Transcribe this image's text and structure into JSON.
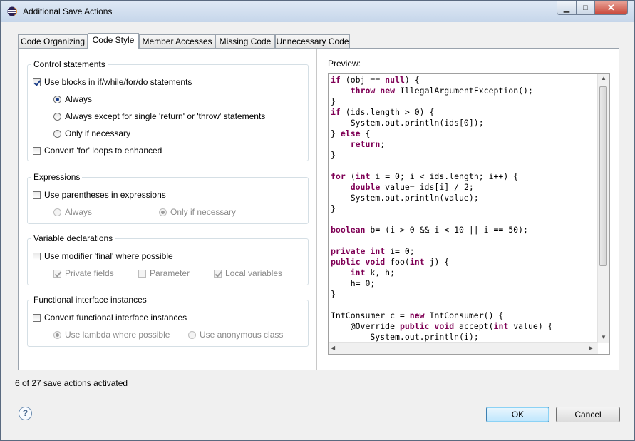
{
  "window": {
    "title": "Additional Save Actions",
    "controls": {
      "minimize": "▁",
      "maximize": "□",
      "close": "✕"
    }
  },
  "tabs": [
    {
      "label": "Code Organizing",
      "active": false
    },
    {
      "label": "Code Style",
      "active": true
    },
    {
      "label": "Member Accesses",
      "active": false
    },
    {
      "label": "Missing Code",
      "active": false
    },
    {
      "label": "Unnecessary Code",
      "active": false
    }
  ],
  "groups": {
    "control": {
      "label": "Control statements",
      "use_blocks": {
        "label": "Use blocks in if/while/for/do statements",
        "checked": true
      },
      "always": {
        "label": "Always",
        "checked": true
      },
      "always_except": {
        "label": "Always except for single 'return' or 'throw' statements",
        "checked": false
      },
      "only_if_necessary": {
        "label": "Only if necessary",
        "checked": false
      },
      "convert_for": {
        "label": "Convert 'for' loops to enhanced",
        "checked": false
      }
    },
    "expressions": {
      "label": "Expressions",
      "use_parentheses": {
        "label": "Use parentheses in expressions",
        "checked": false
      },
      "always": {
        "label": "Always",
        "checked": false
      },
      "only_if_necessary": {
        "label": "Only if necessary",
        "checked": true
      }
    },
    "variables": {
      "label": "Variable declarations",
      "use_final": {
        "label": "Use modifier 'final' where possible",
        "checked": false
      },
      "private_fields": {
        "label": "Private fields",
        "checked": true
      },
      "parameter": {
        "label": "Parameter",
        "checked": false
      },
      "local_variables": {
        "label": "Local variables",
        "checked": true
      }
    },
    "functional": {
      "label": "Functional interface instances",
      "convert": {
        "label": "Convert functional interface instances",
        "checked": false
      },
      "use_lambda": {
        "label": "Use lambda where possible",
        "checked": true
      },
      "use_anonymous": {
        "label": "Use anonymous class",
        "checked": false
      }
    }
  },
  "preview": {
    "label": "Preview:",
    "lines": [
      [
        [
          "kw",
          "if"
        ],
        [
          "t",
          " (obj == "
        ],
        [
          "kw",
          "null"
        ],
        [
          "t",
          ") {"
        ]
      ],
      [
        [
          "t",
          "    "
        ],
        [
          "kw",
          "throw"
        ],
        [
          "t",
          " "
        ],
        [
          "kw",
          "new"
        ],
        [
          "t",
          " IllegalArgumentException();"
        ]
      ],
      [
        [
          "t",
          "}"
        ]
      ],
      [
        [
          "kw",
          "if"
        ],
        [
          "t",
          " (ids.length > 0) {"
        ]
      ],
      [
        [
          "t",
          "    System.out.println(ids[0]);"
        ]
      ],
      [
        [
          "t",
          "} "
        ],
        [
          "kw",
          "else"
        ],
        [
          "t",
          " {"
        ]
      ],
      [
        [
          "t",
          "    "
        ],
        [
          "kw",
          "return"
        ],
        [
          "t",
          ";"
        ]
      ],
      [
        [
          "t",
          "}"
        ]
      ],
      [
        [
          "t",
          ""
        ]
      ],
      [
        [
          "kw",
          "for"
        ],
        [
          "t",
          " ("
        ],
        [
          "kw",
          "int"
        ],
        [
          "t",
          " i = 0; i < ids.length; i++) {"
        ]
      ],
      [
        [
          "t",
          "    "
        ],
        [
          "kw",
          "double"
        ],
        [
          "t",
          " value= ids[i] / 2;"
        ]
      ],
      [
        [
          "t",
          "    System.out.println(value);"
        ]
      ],
      [
        [
          "t",
          "}"
        ]
      ],
      [
        [
          "t",
          ""
        ]
      ],
      [
        [
          "kw",
          "boolean"
        ],
        [
          "t",
          " b= (i > 0 && i < 10 || i == 50);"
        ]
      ],
      [
        [
          "t",
          ""
        ]
      ],
      [
        [
          "kw",
          "private"
        ],
        [
          "t",
          " "
        ],
        [
          "kw",
          "int"
        ],
        [
          "t",
          " i= 0;"
        ]
      ],
      [
        [
          "kw",
          "public"
        ],
        [
          "t",
          " "
        ],
        [
          "kw",
          "void"
        ],
        [
          "t",
          " foo("
        ],
        [
          "kw",
          "int"
        ],
        [
          "t",
          " j) {"
        ]
      ],
      [
        [
          "t",
          "    "
        ],
        [
          "kw",
          "int"
        ],
        [
          "t",
          " k, h;"
        ]
      ],
      [
        [
          "t",
          "    h= 0;"
        ]
      ],
      [
        [
          "t",
          "}"
        ]
      ],
      [
        [
          "t",
          ""
        ]
      ],
      [
        [
          "t",
          "IntConsumer c = "
        ],
        [
          "kw",
          "new"
        ],
        [
          "t",
          " IntConsumer() {"
        ]
      ],
      [
        [
          "t",
          "    @Override "
        ],
        [
          "kw",
          "public"
        ],
        [
          "t",
          " "
        ],
        [
          "kw",
          "void"
        ],
        [
          "t",
          " accept("
        ],
        [
          "kw",
          "int"
        ],
        [
          "t",
          " value) {"
        ]
      ],
      [
        [
          "t",
          "        System.out.println(i);"
        ]
      ]
    ]
  },
  "status": "6 of 27 save actions activated",
  "buttons": {
    "help": "?",
    "ok": "OK",
    "cancel": "Cancel"
  },
  "colors": {
    "keyword": "#7f0055",
    "ok_border": "#3c7fb1"
  }
}
